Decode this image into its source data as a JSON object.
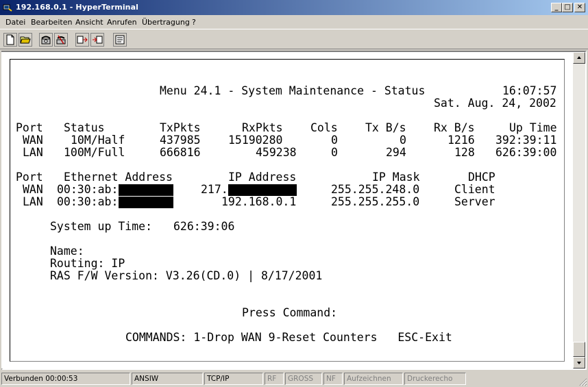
{
  "window": {
    "title": "192.168.0.1 - HyperTerminal"
  },
  "menu": [
    "Datei",
    "Bearbeiten",
    "Ansicht",
    "Anrufen",
    "Übertragung",
    "?"
  ],
  "toolbar": [
    "new-icon",
    "open-icon",
    "call-icon",
    "disconnect-icon",
    "send-icon",
    "receive-icon",
    "properties-icon"
  ],
  "terminal": {
    "header_title": "Menu 24.1 - System Maintenance - Status",
    "time": "16:07:57",
    "date": "Sat. Aug. 24, 2002",
    "ports": {
      "headers": [
        "Port",
        "Status",
        "TxPkts",
        "RxPkts",
        "Cols",
        "Tx B/s",
        "Rx B/s",
        "Up Time"
      ],
      "rows": [
        [
          "WAN",
          "10M/Half",
          "437985",
          "15190280",
          "0",
          "0",
          "1216",
          "392:39:11"
        ],
        [
          "LAN",
          "100M/Full",
          "666816",
          "459238",
          "0",
          "294",
          "128",
          "626:39:00"
        ]
      ]
    },
    "net": {
      "headers": [
        "Port",
        "Ethernet Address",
        "IP Address",
        "IP Mask",
        "DHCP"
      ],
      "rows": [
        [
          "WAN",
          "00:30:ab:",
          "217.",
          "255.255.248.0",
          "Client"
        ],
        [
          "LAN",
          "00:30:ab:",
          "192.168.0.1",
          "255.255.255.0",
          "Server"
        ]
      ]
    },
    "uptime_label": "System up Time:",
    "uptime_value": "626:39:06",
    "name_line": "Name:",
    "routing_line": "Routing: IP",
    "fw_line": "RAS F/W Version: V3.26(CD.0) | 8/17/2001",
    "prompt": "Press Command:",
    "commands": "COMMANDS: 1-Drop WAN 9-Reset Counters   ESC-Exit"
  },
  "statusbar": [
    {
      "label": "Verbunden 00:00:53",
      "enabled": true
    },
    {
      "label": "ANSIW",
      "enabled": true
    },
    {
      "label": "TCP/IP",
      "enabled": true
    },
    {
      "label": "RF",
      "enabled": false
    },
    {
      "label": "GROSS",
      "enabled": false
    },
    {
      "label": "NF",
      "enabled": false
    },
    {
      "label": "Aufzeichnen",
      "enabled": false
    },
    {
      "label": "Druckerecho",
      "enabled": false
    }
  ]
}
